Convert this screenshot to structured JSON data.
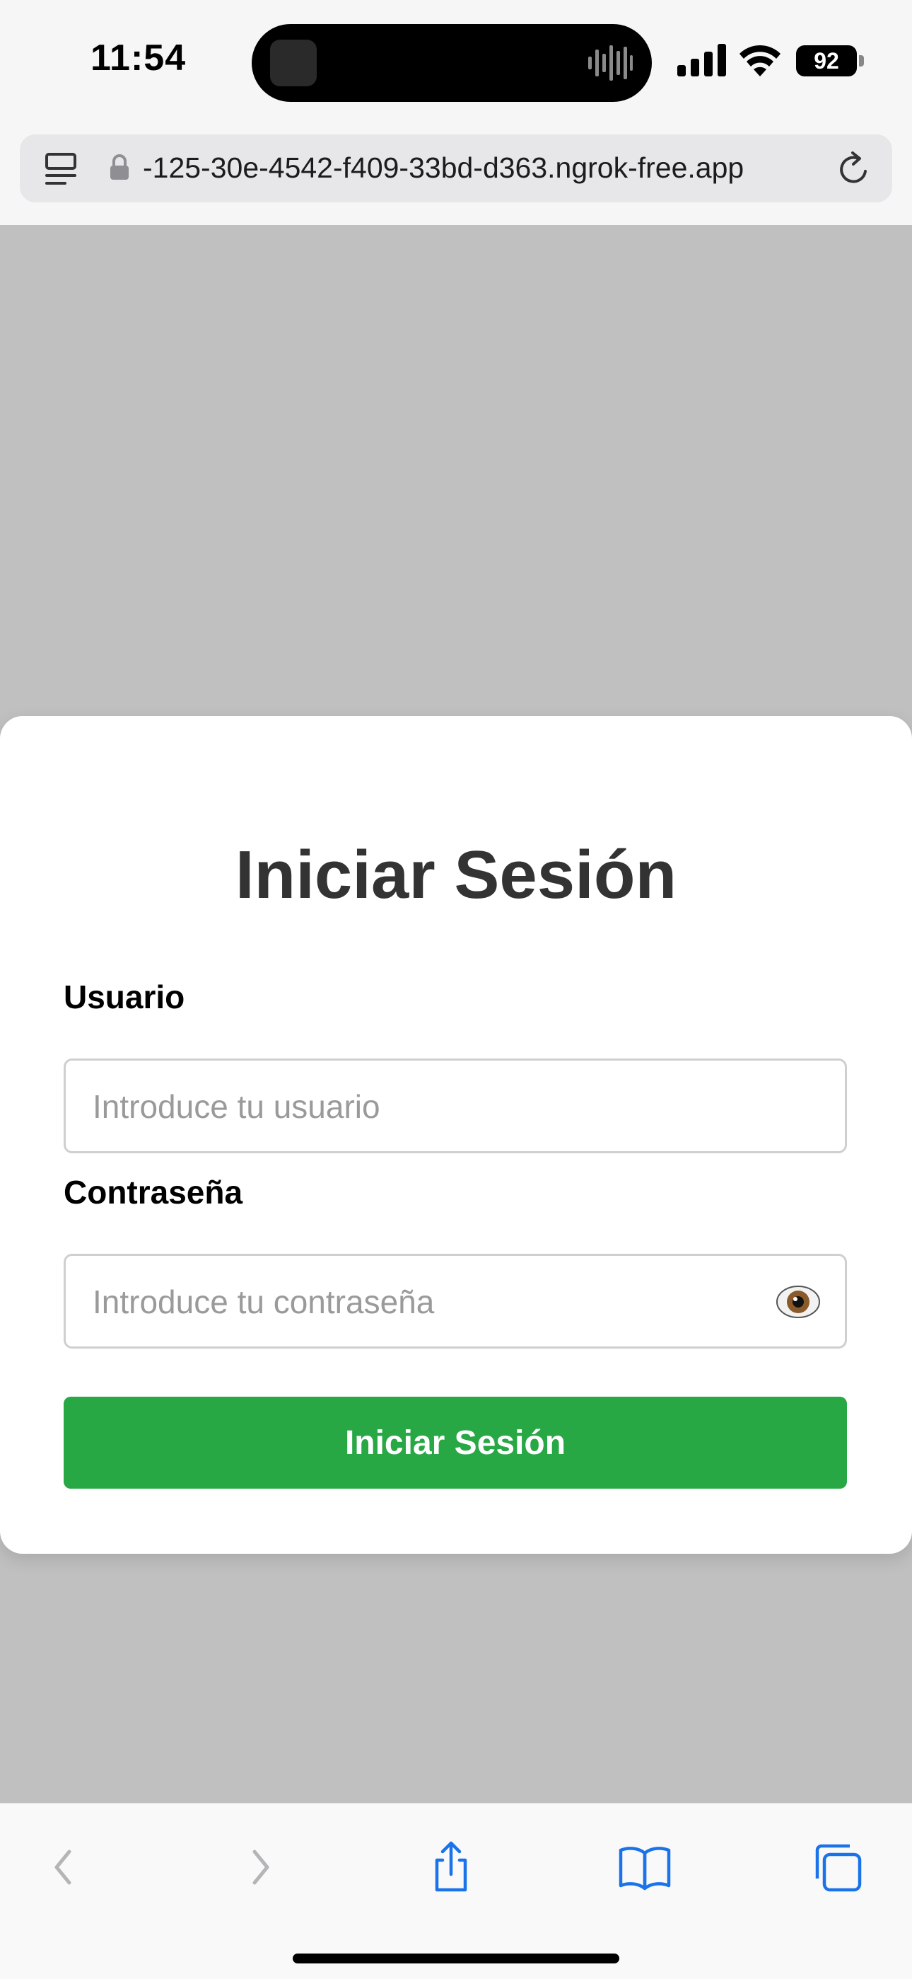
{
  "status_bar": {
    "time": "11:54",
    "battery_level": "92",
    "icons": [
      "signal-icon",
      "wifi-icon",
      "battery-icon"
    ]
  },
  "browser": {
    "url": "-125-30e-4542-f409-33bd-d363.ngrok-free.app",
    "icons": [
      "reader-icon",
      "lock-icon",
      "reload-icon"
    ]
  },
  "login": {
    "title": "Iniciar Sesión",
    "username_label": "Usuario",
    "username_placeholder": "Introduce tu usuario",
    "password_label": "Contraseña",
    "password_placeholder": "Introduce tu contraseña",
    "submit_label": "Iniciar Sesión"
  },
  "toolbar": {
    "icons": [
      "back-icon",
      "forward-icon",
      "share-icon",
      "bookmarks-icon",
      "tabs-icon"
    ]
  },
  "colors": {
    "accent": "#28a745",
    "link": "#1a73e8",
    "overlay": "#c0c0c0"
  }
}
